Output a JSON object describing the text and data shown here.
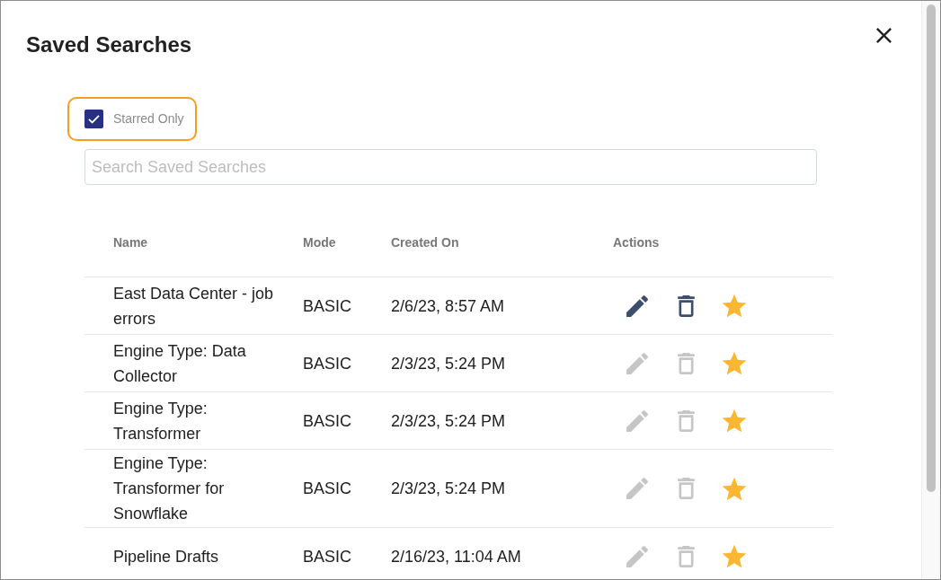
{
  "dialog": {
    "title": "Saved Searches"
  },
  "filter": {
    "label": "Starred Only",
    "checked": true,
    "highlighted": true
  },
  "search": {
    "placeholder": "Search Saved Searches"
  },
  "table": {
    "columns": [
      "Name",
      "Mode",
      "Created On",
      "Actions"
    ],
    "rows": [
      {
        "name": "East Data Center - job errors",
        "mode": "BASIC",
        "created_on": "2/6/23, 8:57 AM",
        "hovered": true,
        "starred": true
      },
      {
        "name": "Engine Type: Data Collector",
        "mode": "BASIC",
        "created_on": "2/3/23, 5:24 PM",
        "hovered": false,
        "starred": true
      },
      {
        "name": "Engine Type: Transformer",
        "mode": "BASIC",
        "created_on": "2/3/23, 5:24 PM",
        "hovered": false,
        "starred": true
      },
      {
        "name": "Engine Type: Transformer for Snowflake",
        "mode": "BASIC",
        "created_on": "2/3/23, 5:24 PM",
        "hovered": false,
        "starred": true
      },
      {
        "name": "Pipeline Drafts",
        "mode": "BASIC",
        "created_on": "2/16/23, 11:04 AM",
        "hovered": false,
        "starred": true
      }
    ]
  }
}
